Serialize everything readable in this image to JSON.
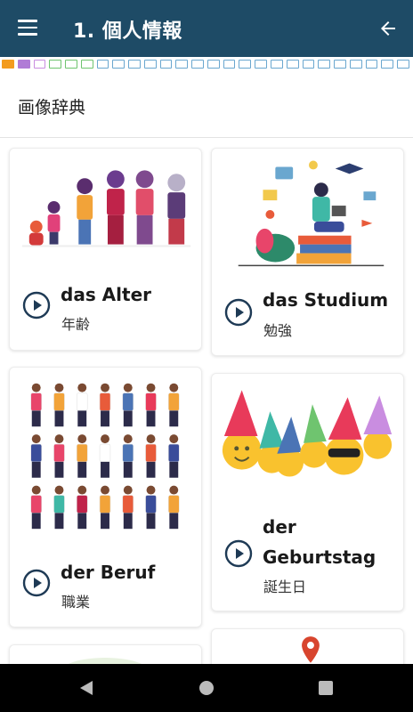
{
  "appbar": {
    "title": "1. 個人情報",
    "menu_icon": "hamburger-menu-icon",
    "back_icon": "arrow-back-icon",
    "background": "#1e4b66"
  },
  "progress": {
    "colors": [
      "#f39c1f",
      "#b07cd6",
      "#c98de0",
      "#6fc46f",
      "#6fc46f",
      "#6fc46f",
      "#6aa7cf",
      "#6aa7cf",
      "#6aa7cf",
      "#6aa7cf",
      "#6aa7cf",
      "#6aa7cf",
      "#6aa7cf",
      "#6aa7cf",
      "#6aa7cf",
      "#6aa7cf",
      "#6aa7cf",
      "#6aa7cf",
      "#6aa7cf",
      "#6aa7cf",
      "#6aa7cf",
      "#6aa7cf",
      "#6aa7cf",
      "#6aa7cf",
      "#6aa7cf",
      "#6aa7cf"
    ],
    "filled_count": 2
  },
  "section": {
    "title": "画像辞典"
  },
  "cards": [
    {
      "word": "das Alter",
      "translation": "年齢"
    },
    {
      "word": "das Studium",
      "translation": "勉強"
    },
    {
      "word": "der Beruf",
      "translation": "職業"
    },
    {
      "word_line1": "der",
      "word_line2": "Geburtstag",
      "translation": "誕生日"
    }
  ],
  "navbar": {
    "back_icon": "triangle-back-icon",
    "home_icon": "circle-home-icon",
    "recents_icon": "square-recents-icon"
  }
}
